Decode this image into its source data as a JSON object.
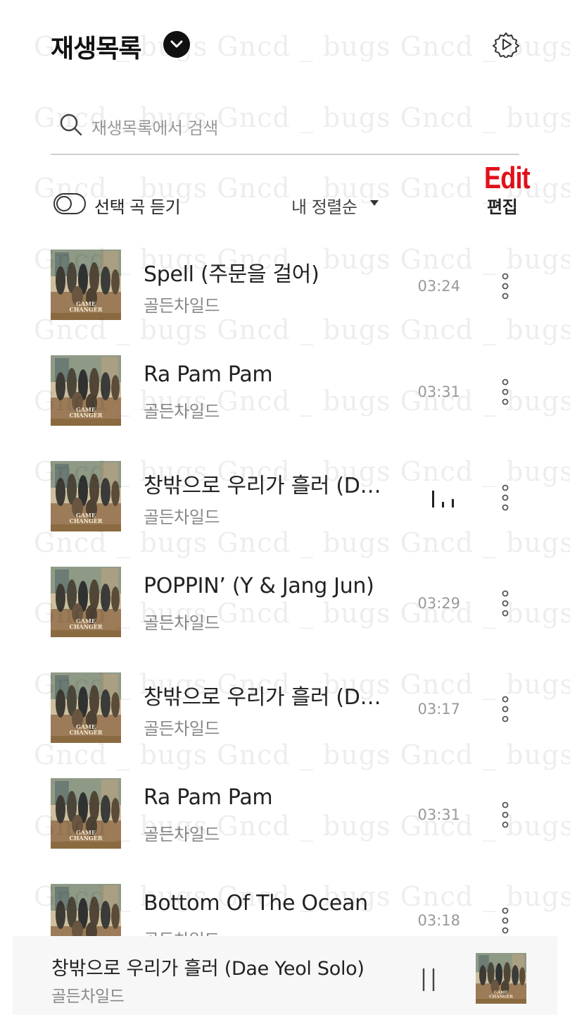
{
  "header": {
    "title": "재생목록",
    "dropdown_icon": "chevron-down-icon",
    "settings_icon": "gear-play-icon"
  },
  "search": {
    "placeholder": "재생목록에서 검색",
    "icon": "search-icon"
  },
  "controls": {
    "select_play_label": "선택 곡 듣기",
    "select_play_on": false,
    "sort_label": "내 정렬순",
    "edit_annotation": "Edit",
    "edit_label": "편집",
    "annotation_color": "#e3101a"
  },
  "songs": [
    {
      "title": "Spell (주문을 걸어)",
      "artist": "골든차일드",
      "duration": "03:24",
      "playing": false
    },
    {
      "title": "Ra Pam Pam",
      "artist": "골든차일드",
      "duration": "03:31",
      "playing": false
    },
    {
      "title": "창밖으로 우리가 흘러 (D…",
      "artist": "골든차일드",
      "duration": "",
      "playing": true
    },
    {
      "title": "POPPIN’ (Y & Jang Jun)",
      "artist": "골든차일드",
      "duration": "03:29",
      "playing": false
    },
    {
      "title": "창밖으로 우리가 흘러 (D…",
      "artist": "골든차일드",
      "duration": "03:17",
      "playing": false
    },
    {
      "title": "Ra Pam Pam",
      "artist": "골든차일드",
      "duration": "03:31",
      "playing": false
    },
    {
      "title": "Bottom Of The Ocean",
      "artist": "골든차일드",
      "duration": "03:18",
      "playing": false
    }
  ],
  "album_art": {
    "text_line1": "GAME",
    "text_line2": "CHANGER"
  },
  "now_playing": {
    "title": "창밖으로 우리가 흘러 (Dae Yeol Solo)",
    "artist": "골든차일드",
    "control_icon": "pause-icon"
  },
  "watermark": {
    "text": "Gncd _ bugs  Gncd _ bugs  Gncd _ bugs"
  }
}
